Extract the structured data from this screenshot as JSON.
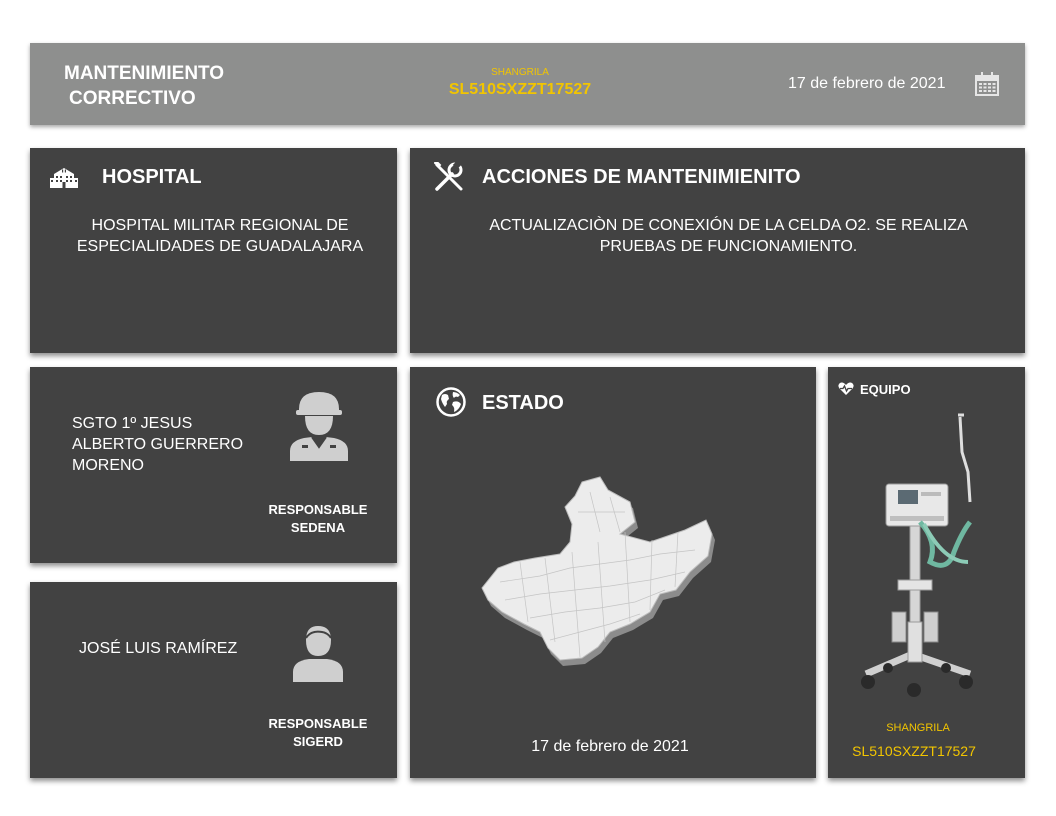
{
  "header": {
    "title_line1": "MANTENIMIENTO",
    "title_line2": "CORRECTIVO",
    "brand": "SHANGRILA",
    "serial": "SL510SXZZT17527",
    "date": "17 de febrero de 2021",
    "calendar_icon": "calendar-icon"
  },
  "hospital": {
    "title": "HOSPITAL",
    "icon": "hospital-icon",
    "name_line1": "HOSPITAL MILITAR REGIONAL DE",
    "name_line2": "ESPECIALIDADES DE GUADALAJARA"
  },
  "acciones": {
    "title": "ACCIONES DE MANTENIMIENITO",
    "icon": "tools-icon",
    "text_line1": "ACTUALIZACIÒN DE CONEXIÓN DE LA CELDA O2. SE REALIZA",
    "text_line2": "PRUEBAS DE FUNCIONAMIENTO."
  },
  "sedena": {
    "name_line1": "SGTO 1º JESUS",
    "name_line2": "ALBERTO GUERRERO",
    "name_line3": "MORENO",
    "resp_line1": "RESPONSABLE",
    "resp_line2": "SEDENA",
    "icon": "soldier-avatar-icon"
  },
  "sigerd": {
    "name": "JOSÉ LUIS RAMÍREZ",
    "resp_line1": "RESPONSABLE",
    "resp_line2": "SIGERD",
    "icon": "person-avatar-icon"
  },
  "estado": {
    "title": "ESTADO",
    "icon": "globe-icon",
    "map": "jalisco-map",
    "date": "17 de febrero de 2021"
  },
  "equipo": {
    "title": "EQUIPO",
    "icon": "heart-pulse-icon",
    "image": "ventilator-image",
    "brand": "SHANGRILA",
    "serial": "SL510SXZZT17527"
  },
  "colors": {
    "header_bg": "#8e8f8e",
    "panel_bg": "#424242",
    "accent_yellow": "#f2c500",
    "text": "#ffffff"
  }
}
